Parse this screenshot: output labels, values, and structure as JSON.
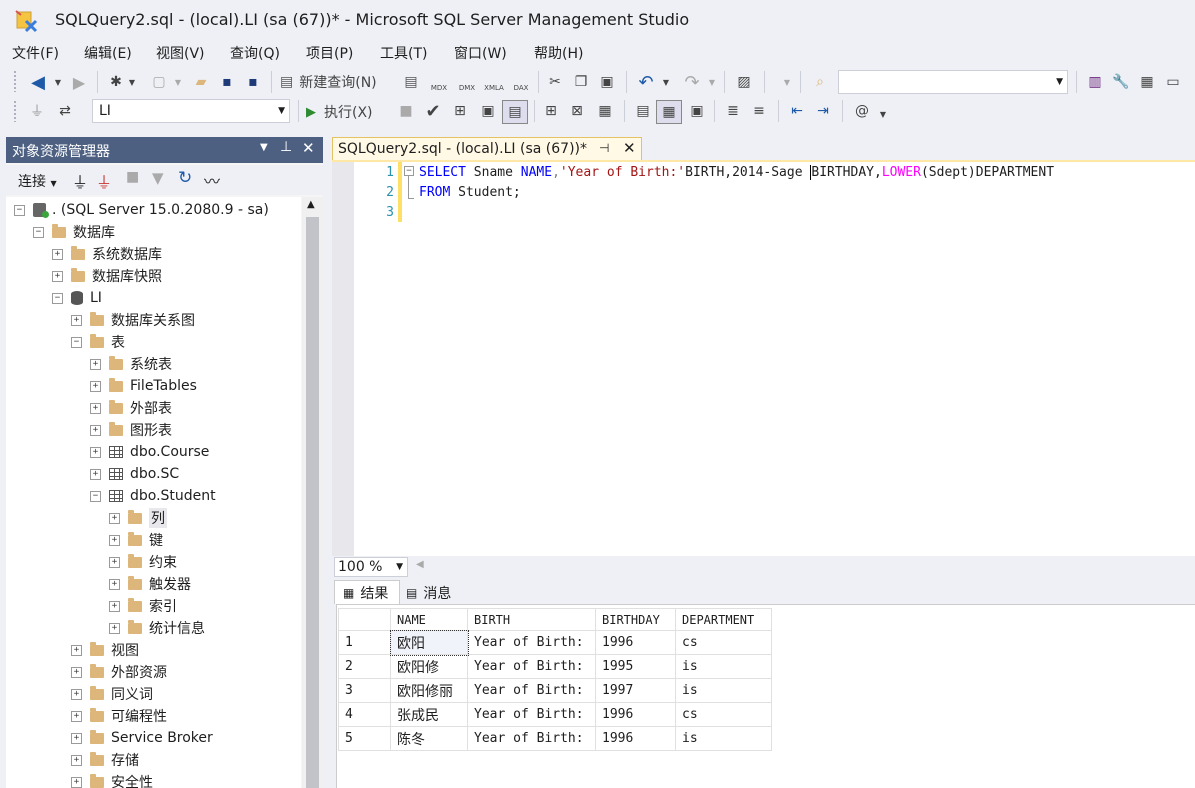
{
  "window": {
    "title": "SQLQuery2.sql - (local).LI (sa (67))* - Microsoft SQL Server Management Studio"
  },
  "menu": [
    "文件(F)",
    "编辑(E)",
    "视图(V)",
    "查询(Q)",
    "项目(P)",
    "工具(T)",
    "窗口(W)",
    "帮助(H)"
  ],
  "toolbar1": {
    "new_query": "新建查询(N)",
    "mdx": "MDX",
    "dmx": "DMX",
    "xmla": "XMLA",
    "dax": "DAX",
    "search_value": ""
  },
  "toolbar2": {
    "database": "LI",
    "execute": "执行(X)"
  },
  "object_explorer": {
    "title": "对象资源管理器",
    "connect": "连接",
    "nodes": [
      {
        "label": ". (SQL Server 15.0.2080.9 - sa)",
        "icon": "server-icon",
        "exp": "−"
      },
      {
        "label": "数据库",
        "icon": "folder-icon",
        "exp": "−"
      },
      {
        "label": "系统数据库",
        "icon": "folder-icon",
        "exp": "+"
      },
      {
        "label": "数据库快照",
        "icon": "folder-icon",
        "exp": "+"
      },
      {
        "label": "LI",
        "icon": "database-icon",
        "exp": "−"
      },
      {
        "label": "数据库关系图",
        "icon": "folder-icon",
        "exp": "+"
      },
      {
        "label": "表",
        "icon": "folder-icon",
        "exp": "−"
      },
      {
        "label": "系统表",
        "icon": "folder-icon",
        "exp": "+"
      },
      {
        "label": "FileTables",
        "icon": "folder-icon",
        "exp": "+"
      },
      {
        "label": "外部表",
        "icon": "folder-icon",
        "exp": "+"
      },
      {
        "label": "图形表",
        "icon": "folder-icon",
        "exp": "+"
      },
      {
        "label": "dbo.Course",
        "icon": "table-icon",
        "exp": "+"
      },
      {
        "label": "dbo.SC",
        "icon": "table-icon",
        "exp": "+"
      },
      {
        "label": "dbo.Student",
        "icon": "table-icon",
        "exp": "−"
      },
      {
        "label": "列",
        "icon": "folder-icon",
        "exp": "+"
      },
      {
        "label": "键",
        "icon": "folder-icon",
        "exp": "+"
      },
      {
        "label": "约束",
        "icon": "folder-icon",
        "exp": "+"
      },
      {
        "label": "触发器",
        "icon": "folder-icon",
        "exp": "+"
      },
      {
        "label": "索引",
        "icon": "folder-icon",
        "exp": "+"
      },
      {
        "label": "统计信息",
        "icon": "folder-icon",
        "exp": "+"
      },
      {
        "label": "视图",
        "icon": "folder-icon",
        "exp": "+"
      },
      {
        "label": "外部资源",
        "icon": "folder-icon",
        "exp": "+"
      },
      {
        "label": "同义词",
        "icon": "folder-icon",
        "exp": "+"
      },
      {
        "label": "可编程性",
        "icon": "folder-icon",
        "exp": "+"
      },
      {
        "label": "Service Broker",
        "icon": "folder-icon",
        "exp": "+"
      },
      {
        "label": "存储",
        "icon": "folder-icon",
        "exp": "+"
      },
      {
        "label": "安全性",
        "icon": "folder-icon",
        "exp": "+"
      }
    ]
  },
  "editor": {
    "tab_title": "SQLQuery2.sql - (local).LI (sa (67))*",
    "line_numbers": [
      "1",
      "2",
      "3"
    ],
    "line1": {
      "kw1": "SELECT",
      "t1": " Sname ",
      "kw2": "NAME",
      "t2": ",",
      "str": "'Year of Birth:'",
      "t3": "BIRTH,2014-Sage ",
      "t4": "BIRTHDAY,",
      "fn": "LOWER",
      "t5": "(Sdept)DEPARTMENT"
    },
    "line2": {
      "kw": "FROM",
      "t": " Student;"
    },
    "zoom": "100 %"
  },
  "results": {
    "tab_results": "结果",
    "tab_messages": "消息",
    "columns": [
      "NAME",
      "BIRTH",
      "BIRTHDAY",
      "DEPARTMENT"
    ],
    "rows": [
      [
        "1",
        "欧阳",
        "Year of Birth:",
        "1996",
        "cs"
      ],
      [
        "2",
        "欧阳修",
        "Year of Birth:",
        "1995",
        "is"
      ],
      [
        "3",
        "欧阳修丽",
        "Year of Birth:",
        "1997",
        "is"
      ],
      [
        "4",
        "张成民",
        "Year of Birth:",
        "1996",
        "cs"
      ],
      [
        "5",
        "陈冬",
        "Year of Birth:",
        "1996",
        "is"
      ]
    ]
  },
  "colors": {
    "accent": "#4d6082",
    "keyword": "#0000ff",
    "string": "#a31515",
    "function": "#ff00ff",
    "tab_active": "#fff9e6"
  }
}
